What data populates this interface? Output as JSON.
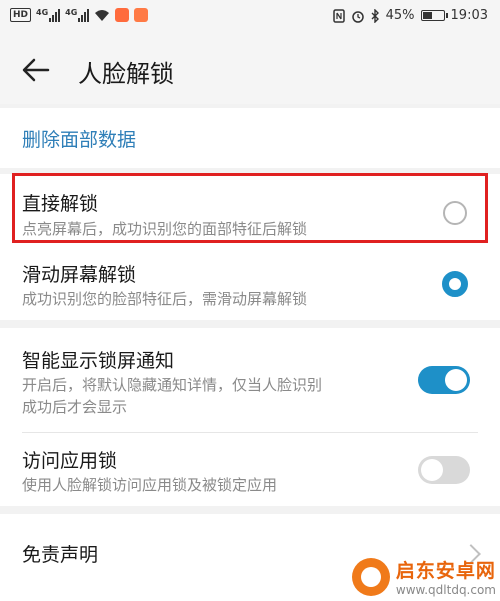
{
  "status_bar": {
    "hd": "HD",
    "net1": "4G",
    "net2": "4G",
    "battery_text": "45%",
    "battery_level": 0.45,
    "time": "19:03"
  },
  "header": {
    "title": "人脸解锁",
    "back_icon": "arrow-left-icon"
  },
  "delete_face_data": "删除面部数据",
  "unlock_options": [
    {
      "title": "直接解锁",
      "subtitle": "点亮屏幕后，成功识别您的面部特征后解锁",
      "selected": false
    },
    {
      "title": "滑动屏幕解锁",
      "subtitle": "成功识别您的脸部特征后，需滑动屏幕解锁",
      "selected": true
    }
  ],
  "smart_notification": {
    "title": "智能显示锁屏通知",
    "subtitle_line1": "开启后，将默认隐藏通知详情，仅当人脸识别",
    "subtitle_line2": "成功后才会显示",
    "enabled": true
  },
  "app_lock": {
    "title": "访问应用锁",
    "subtitle": "使用人脸解锁访问应用锁及被锁定应用",
    "enabled": false
  },
  "disclaimer": "免责声明",
  "watermark": {
    "main": "启东安卓网",
    "url": "www.qdltdq.com"
  },
  "colors": {
    "accent": "#1e90c8",
    "link": "#2f7fb8",
    "highlight": "#e02020"
  }
}
